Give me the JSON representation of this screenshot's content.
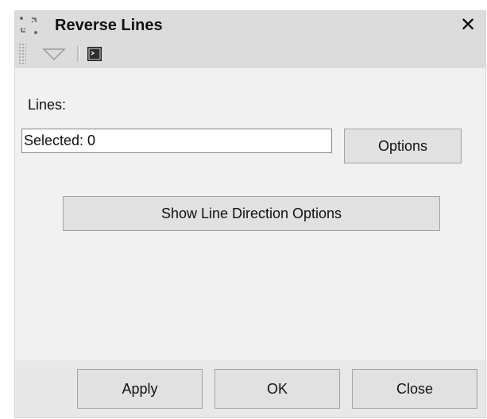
{
  "window": {
    "title": "Reverse Lines",
    "close_glyph": "✕",
    "title_icon": "reverse-arrows-icon"
  },
  "toolbar": {
    "dropdown_icon": "triangle-down-icon",
    "console_icon": "console-window-icon"
  },
  "lines": {
    "label": "Lines:",
    "selected_value": "Selected: 0",
    "options_button": "Options"
  },
  "show_direction_button": "Show Line Direction Options",
  "footer": {
    "apply": "Apply",
    "ok": "OK",
    "close": "Close"
  },
  "colors": {
    "titlebar_bg": "#dcdcdc",
    "panel_bg": "#f1f1f1",
    "button_bg": "#e1e1e1",
    "button_border": "#a4a4a4"
  }
}
